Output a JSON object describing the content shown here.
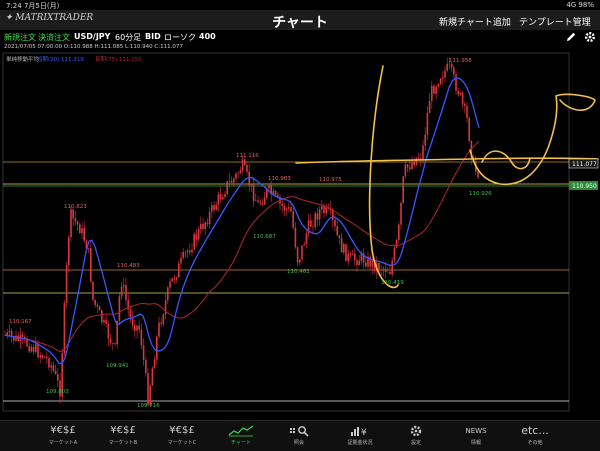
{
  "status": {
    "time": "7:24",
    "date": "7月5日(月)",
    "signal": "4G 98%"
  },
  "app": {
    "logo": "MATRIXTRADER",
    "title": "チャート",
    "add_chart": "新規チャート追加",
    "template": "テンプレート管理"
  },
  "toolbar": {
    "new_order": "新規注文",
    "settle_order": "決済注文",
    "pair": "USD/JPY",
    "interval": "60分足",
    "side": "BID",
    "chart_kind": "ローソク",
    "count": "400"
  },
  "ohlc": {
    "datetime": "2021/07/05 07:00:00",
    "open": "O:110.988",
    "high": "H:111.085",
    "low": "L:110.940",
    "close": "C:111.077"
  },
  "indicator": {
    "name": "単純移動平均",
    "short_label": "短期(20)",
    "short_value": "111.319",
    "long_label": "長期(75)",
    "long_value": "111.150"
  },
  "price_tags": {
    "current": "111.077",
    "line": "110.950"
  },
  "annotations": {
    "high": "111.958",
    "t1": "111.116",
    "t2": "110.983",
    "t3": "110.975",
    "a1": "110.823",
    "a2": "110.483",
    "a3": "110.167",
    "l1": "110.687",
    "l2": "110.461",
    "l3": "110.419",
    "b1": "109.941",
    "b2": "109.803",
    "b3": "109.716",
    "r1": "110.926"
  },
  "colors": {
    "short_ma": "#3a56ff",
    "long_ma": "#b3242f",
    "candles": "#d9383f",
    "hline_orange": "#c98a2a",
    "hline_yellow": "#d8d860",
    "drawing": "#f2c14a",
    "accent": "#35d64a"
  },
  "tabs": [
    {
      "label": "マーケットA",
      "icon": "¥€$£"
    },
    {
      "label": "マーケットB",
      "icon": "¥€$£"
    },
    {
      "label": "マーケットC",
      "icon": "¥€$£"
    },
    {
      "label": "チャート",
      "icon": "chart-icon"
    },
    {
      "label": "照会",
      "icon": "search-icon"
    },
    {
      "label": "証拠金状況",
      "icon": "margin-icon"
    },
    {
      "label": "設定",
      "icon": "gear-icon"
    },
    {
      "label": "情報",
      "icon": "NEWS"
    },
    {
      "label": "その他",
      "icon": "etc..."
    }
  ]
}
